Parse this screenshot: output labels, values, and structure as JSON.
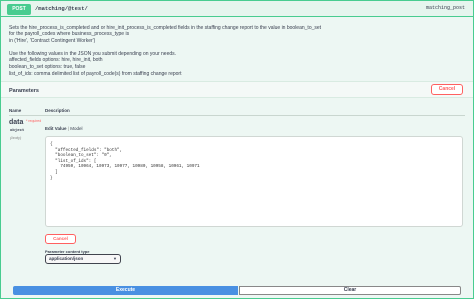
{
  "operation": {
    "method": "POST",
    "path": "/matching/@test/",
    "operation_id": "matching_post",
    "accent_color": "#49cc90"
  },
  "description": {
    "lines": [
      "Sets the hire_process_is_completed and or hire_init_process_is_completed fields in the staffing change report to the value in boolean_to_set",
      "for the payroll_codes where business_process_type is",
      "in ('Hire', 'Contract Contingent Worker')"
    ],
    "usage_lines": [
      "Use the following values in the JSON you submit depending on your needs.",
      "affected_fields options: hire, hire_init, both",
      "boolean_to_set options: true, false",
      "list_of_ids: comma delimited list of payroll_code(s) from staffing change report"
    ]
  },
  "parameters": {
    "title": "Parameters",
    "cancel_label": "Cancel",
    "col_name": "Name",
    "col_description": "Description",
    "param": {
      "name": "data",
      "required_marker": "* required",
      "type": "object",
      "location": "(body)"
    },
    "tabs": {
      "edit_value": "Edit Value",
      "separator": "|",
      "model": "Model"
    },
    "body_value": "{\n  \"affected_fields\": \"both\",\n  \"boolean_to_set\": \"0\",\n  \"list_of_ids\": [\n    74950, 10964, 10973, 10977, 10980, 10958, 10961, 10971\n  ]\n}",
    "cancel_bottom_label": "Cancel",
    "content_type_label": "Parameter content type",
    "content_type_value": "application/json"
  },
  "actions": {
    "execute_label": "Execute",
    "clear_label": "Clear",
    "execute_color": "#4990e2"
  }
}
